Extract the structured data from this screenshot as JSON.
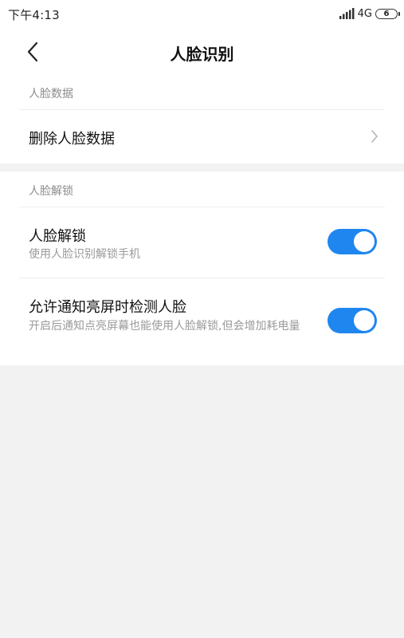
{
  "status_bar": {
    "time": "下午4:13",
    "network": "4G",
    "battery": "6",
    "signal_icon": "signal-bars-icon"
  },
  "header": {
    "back_icon": "chevron-left-icon",
    "title": "人脸识别"
  },
  "sections": [
    {
      "header": "人脸数据",
      "items": [
        {
          "title": "删除人脸数据",
          "icon": "chevron-right-icon"
        }
      ]
    },
    {
      "header": "人脸解锁",
      "items": [
        {
          "title": "人脸解锁",
          "subtitle": "使用人脸识别解锁手机",
          "toggle_on": true
        },
        {
          "title": "允许通知亮屏时检测人脸",
          "subtitle": "开启后通知点亮屏幕也能使用人脸解锁,但会增加耗电量",
          "toggle_on": true
        }
      ]
    }
  ],
  "colors": {
    "accent": "#1f86f0",
    "background": "#f2f2f2",
    "surface": "#ffffff"
  }
}
